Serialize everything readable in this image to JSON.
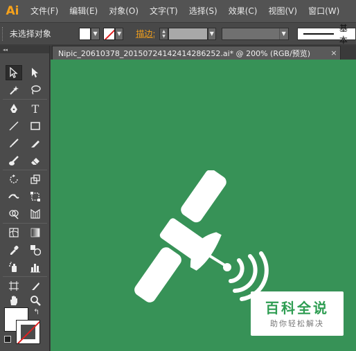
{
  "app": {
    "logo": "Ai"
  },
  "menu": [
    "文件(F)",
    "编辑(E)",
    "对象(O)",
    "文字(T)",
    "选择(S)",
    "效果(C)",
    "视图(V)",
    "窗口(W)"
  ],
  "control_bar": {
    "selection_label": "未选择对象",
    "fill_color": "#ffffff",
    "stroke_label": "描边:",
    "stroke_style_label": "基本"
  },
  "tools_panel": {
    "header": "◂◂",
    "swap_icon": "↰",
    "fill_color": "#ffffff",
    "tools": [
      "selection-tool",
      "direct-selection-tool",
      "magic-wand-tool",
      "lasso-tool",
      "pen-tool",
      "type-tool",
      "line-segment-tool",
      "rectangle-tool",
      "paintbrush-tool",
      "pencil-tool",
      "blob-brush-tool",
      "eraser-tool",
      "rotate-tool",
      "scale-tool",
      "width-tool",
      "free-transform-tool",
      "shape-builder-tool",
      "perspective-grid-tool",
      "mesh-tool",
      "gradient-tool",
      "eyedropper-tool",
      "blend-tool",
      "symbol-sprayer-tool",
      "column-graph-tool",
      "artboard-tool",
      "slice-tool",
      "hand-tool",
      "zoom-tool"
    ]
  },
  "document_tab": {
    "title": "Nipic_20610378_20150724142414286252.ai* @ 200% (RGB/预览)",
    "close": "×"
  },
  "canvas": {
    "background": "#379257",
    "artwork": "satellite-icon"
  },
  "watermark": {
    "title": "百科全说",
    "subtitle": "助你轻松解决"
  }
}
